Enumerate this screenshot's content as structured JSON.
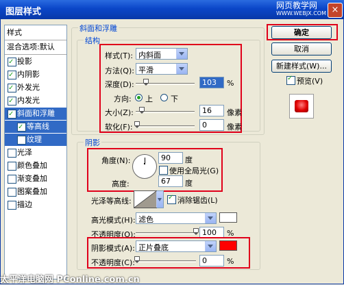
{
  "window": {
    "title": "图层样式",
    "watermark_line1": "网页教学网",
    "watermark_line2": "WWW.WEBJX.COM",
    "close": "×"
  },
  "sidebar": {
    "items": [
      {
        "label": "样式",
        "type": "header",
        "checked": null
      },
      {
        "label": "混合选项:默认",
        "type": "blend",
        "checked": null
      },
      {
        "label": "投影",
        "type": "item",
        "checked": true
      },
      {
        "label": "内阴影",
        "type": "item",
        "checked": true
      },
      {
        "label": "外发光",
        "type": "item",
        "checked": true
      },
      {
        "label": "内发光",
        "type": "item",
        "checked": true
      },
      {
        "label": "斜面和浮雕",
        "type": "selected",
        "checked": true
      },
      {
        "label": "等高线",
        "type": "subsel",
        "checked": true
      },
      {
        "label": "纹理",
        "type": "sub",
        "checked": false
      },
      {
        "label": "光泽",
        "type": "item",
        "checked": false
      },
      {
        "label": "颜色叠加",
        "type": "item",
        "checked": false
      },
      {
        "label": "渐变叠加",
        "type": "item",
        "checked": false
      },
      {
        "label": "图案叠加",
        "type": "item",
        "checked": false
      },
      {
        "label": "描边",
        "type": "item",
        "checked": false
      }
    ]
  },
  "bevel": {
    "group_title": "斜面和浮雕",
    "structure_title": "结构",
    "style_label": "样式(T):",
    "style_value": "内斜面",
    "technique_label": "方法(Q):",
    "technique_value": "平滑",
    "depth_label": "深度(D):",
    "depth_value": "103",
    "depth_unit": "%",
    "direction_label": "方向:",
    "dir_up": "上",
    "dir_down": "下",
    "size_label": "大小(Z):",
    "size_value": "16",
    "size_unit": "像素",
    "soften_label": "软化(F):",
    "soften_value": "0",
    "soften_unit": "像素"
  },
  "shading": {
    "title": "阴影",
    "angle_label": "角度(N):",
    "angle_value": "90",
    "angle_unit": "度",
    "global_light_label": "使用全局光(G)",
    "altitude_label": "高度:",
    "altitude_value": "67",
    "altitude_unit": "度",
    "gloss_label": "光泽等高线:",
    "antialias_label": "消除锯齿(L)",
    "highlight_mode_label": "高光模式(H):",
    "highlight_mode_value": "滤色",
    "highlight_opacity_label": "不透明度(O):",
    "highlight_opacity_value": "100",
    "highlight_opacity_unit": "%",
    "shadow_mode_label": "阴影模式(A):",
    "shadow_mode_value": "正片叠底",
    "shadow_opacity_label": "不透明度(C):",
    "shadow_opacity_value": "0",
    "shadow_opacity_unit": "%",
    "highlight_color": "#ffffff",
    "shadow_color": "#ff0000"
  },
  "buttons": {
    "ok": "确定",
    "cancel": "取消",
    "new_style": "新建样式(W)...",
    "preview_label": "预览(V)"
  },
  "footer": {
    "watermark": "太平洋电脑网 PConline.com.cn"
  },
  "colors": {
    "accent": "#316ac5",
    "highlight": "#e0001a"
  }
}
